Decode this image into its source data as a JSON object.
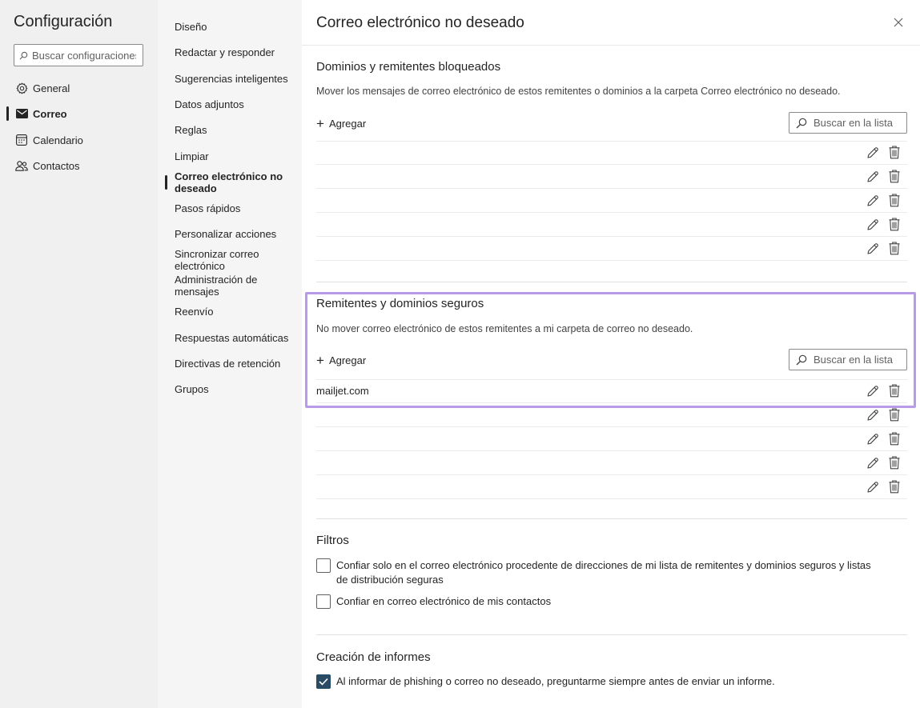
{
  "app": {
    "title": "Configuración"
  },
  "search": {
    "placeholder": "Buscar configuraciones"
  },
  "nav": {
    "items": [
      {
        "label": "General",
        "icon": "gear-icon"
      },
      {
        "label": "Correo",
        "icon": "mail-icon"
      },
      {
        "label": "Calendario",
        "icon": "calendar-icon"
      },
      {
        "label": "Contactos",
        "icon": "people-icon"
      }
    ]
  },
  "subnav": {
    "items": [
      {
        "label": "Diseño"
      },
      {
        "label": "Redactar y responder"
      },
      {
        "label": "Sugerencias inteligentes"
      },
      {
        "label": "Datos adjuntos"
      },
      {
        "label": "Reglas"
      },
      {
        "label": "Limpiar"
      },
      {
        "label": "Correo electrónico no deseado"
      },
      {
        "label": "Pasos rápidos"
      },
      {
        "label": "Personalizar acciones"
      },
      {
        "label": "Sincronizar correo electrónico"
      },
      {
        "label": "Administración de mensajes"
      },
      {
        "label": "Reenvío"
      },
      {
        "label": "Respuestas automáticas"
      },
      {
        "label": "Directivas de retención"
      },
      {
        "label": "Grupos"
      }
    ]
  },
  "main": {
    "title": "Correo electrónico no deseado",
    "blocked": {
      "title": "Dominios y remitentes bloqueados",
      "description": "Mover los mensajes de correo electrónico de estos remitentes o dominios a la carpeta Correo electrónico no deseado.",
      "add_label": "Agregar",
      "search_placeholder": "Buscar en la lista",
      "rows": [
        "",
        "",
        "",
        "",
        ""
      ]
    },
    "safe": {
      "title": "Remitentes y dominios seguros",
      "description": "No mover correo electrónico de estos remitentes a mi carpeta de correo no deseado.",
      "add_label": "Agregar",
      "search_placeholder": "Buscar en la lista",
      "rows": [
        "mailjet.com",
        "",
        "",
        "",
        ""
      ]
    },
    "filters": {
      "title": "Filtros",
      "option1": "Confiar solo en el correo electrónico procedente de direcciones de mi lista de remitentes y dominios seguros y listas de distribución seguras",
      "option1_checked": false,
      "option2": "Confiar en correo electrónico de mis contactos",
      "option2_checked": false
    },
    "reports": {
      "title": "Creación de informes",
      "option1": "Al informar de phishing o correo no deseado, preguntarme siempre antes de enviar un informe.",
      "option1_checked": true
    }
  },
  "colors": {
    "highlight": "#b89ae8",
    "checkbox_checked": "#2b4a63"
  }
}
